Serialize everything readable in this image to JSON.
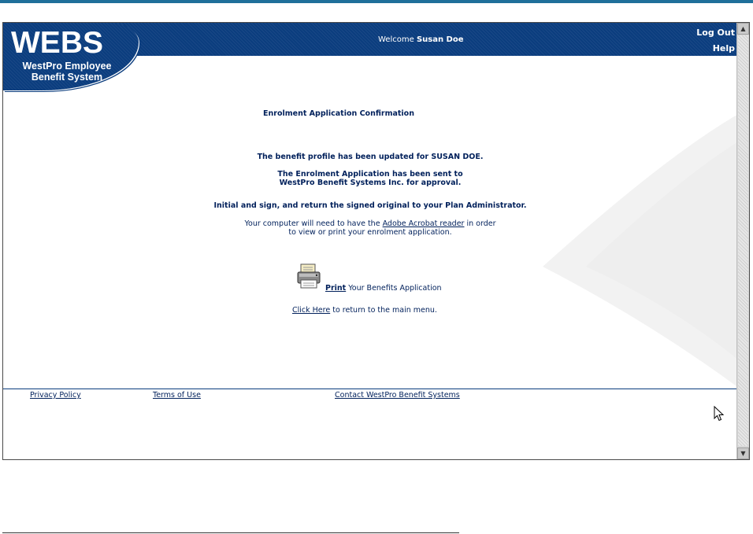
{
  "logo": {
    "main": "WEBS",
    "sub_line1": "WestPro Employee",
    "sub_line2": "Benefit System"
  },
  "header": {
    "welcome_prefix": "Welcome",
    "user_name": "Susan Doe",
    "logout_label": "Log Out",
    "help_label": "Help"
  },
  "main": {
    "title": "Enrolment Application Confirmation",
    "profile_updated": "The benefit profile has been updated for SUSAN DOE.",
    "sent_line1": "The Enrolment Application has been sent to",
    "sent_line2": "WestPro Benefit Systems Inc. for approval.",
    "initial_sign": "Initial and sign, and return the signed original to your Plan Administrator.",
    "acrobat_prefix": "Your computer will need to have the",
    "acrobat_link": "Adobe Acrobat reader",
    "acrobat_suffix": "in order",
    "acrobat_line2": "to view or print your enrolment application.",
    "print_link": "Print",
    "print_text": "Your Benefits Application",
    "return_link": "Click Here",
    "return_text": "to return to the main menu."
  },
  "footer": {
    "privacy": "Privacy Policy",
    "terms": "Terms of Use",
    "contact": "Contact WestPro Benefit Systems"
  },
  "icons": {
    "printer": "printer-icon",
    "cursor": "mouse-cursor-icon",
    "scroll_up": "scroll-up-arrow-icon",
    "scroll_down": "scroll-down-arrow-icon"
  },
  "colors": {
    "brand_blue": "#0b3d7e",
    "text_navy": "#00205b",
    "top_rule": "#1f6f9a"
  }
}
